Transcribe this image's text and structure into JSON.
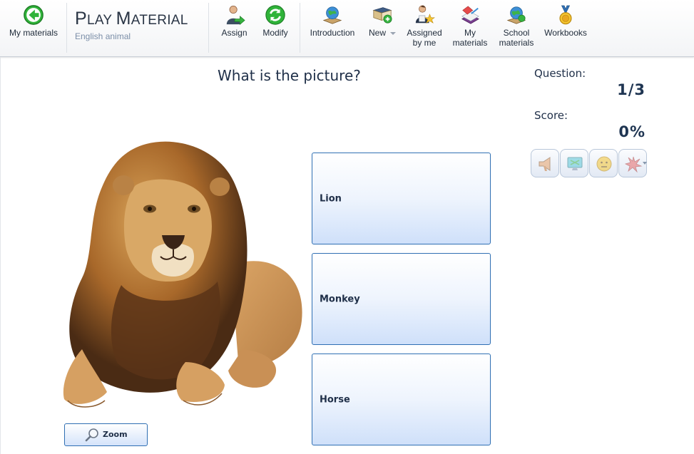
{
  "toolbar": {
    "back_label": "My materials",
    "title_first": "P",
    "title_rest": "LAY ",
    "title_second_first": "M",
    "title_second_rest": "ATERIAL",
    "subtitle": "English animal",
    "assign_label": "Assign",
    "modify_label": "Modify",
    "introduction_label": "Introduction",
    "new_label": "New",
    "assigned_line1": "Assigned",
    "assigned_line2": "by me",
    "my_materials_line1": "My",
    "my_materials_line2": "materials",
    "school_line1": "School",
    "school_line2": "materials",
    "workbooks_label": "Workbooks"
  },
  "quiz": {
    "question": "What is the picture?",
    "answers": [
      "Lion",
      "Monkey",
      "Horse"
    ],
    "zoom_label": "Zoom"
  },
  "status": {
    "question_label": "Question:",
    "question_value": "1/3",
    "score_label": "Score:",
    "score_value": "0%"
  },
  "colors": {
    "accent_border": "#2f6fb3",
    "text_dark": "#1f2f48",
    "back_green": "#2fb339"
  },
  "icons": [
    "back-arrow-icon",
    "assign-user-icon",
    "modify-refresh-icon",
    "introduction-globe-icon",
    "new-book-icon",
    "assigned-teacher-icon",
    "my-materials-book-icon",
    "school-globe-icon",
    "workbooks-medal-icon",
    "zoom-magnifier-icon",
    "megaphone-icon",
    "monitor-icon",
    "smiley-icon",
    "splash-icon"
  ]
}
